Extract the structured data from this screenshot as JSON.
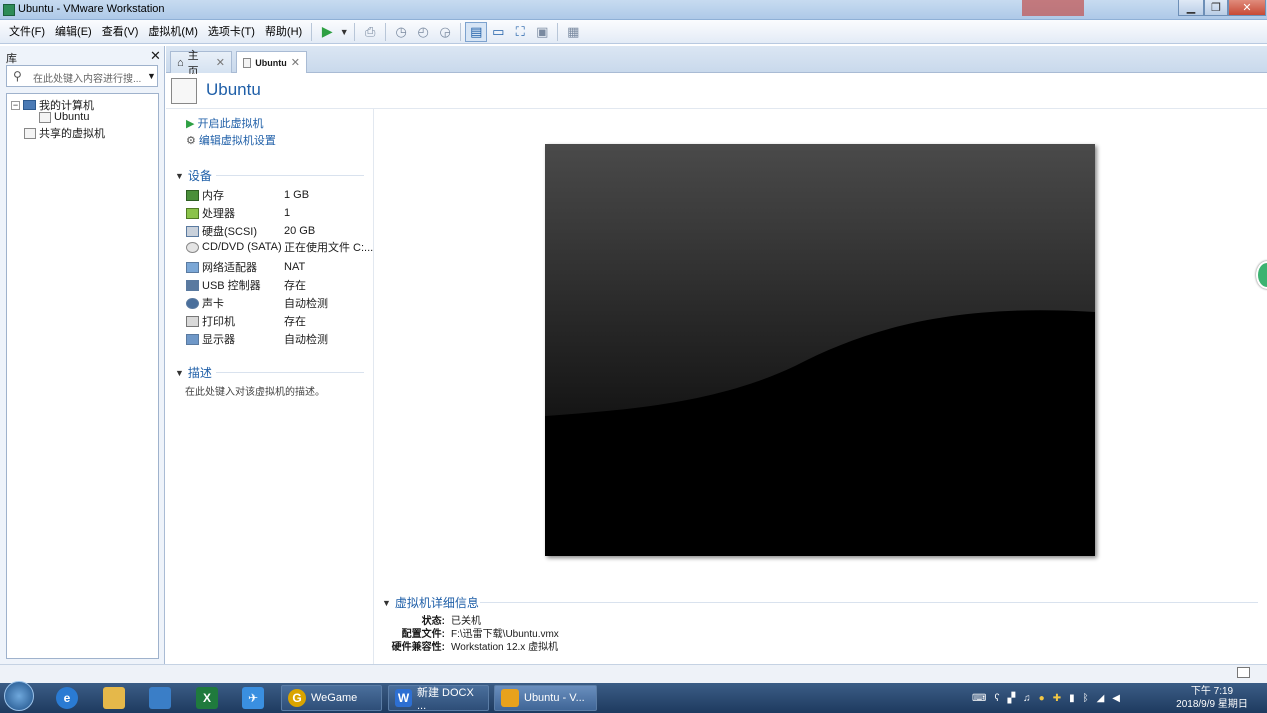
{
  "window": {
    "title": "Ubuntu - VMware Workstation"
  },
  "menu": [
    "文件(F)",
    "编辑(E)",
    "查看(V)",
    "虚拟机(M)",
    "选项卡(T)",
    "帮助(H)"
  ],
  "library": {
    "header": "库",
    "search_placeholder": "在此处键入内容进行搜...",
    "tree": {
      "my_computer": "我的计算机",
      "vm": "Ubuntu",
      "shared": "共享的虚拟机"
    }
  },
  "tabs": [
    {
      "label": "主页"
    },
    {
      "label": "Ubuntu"
    }
  ],
  "vm": {
    "name": "Ubuntu",
    "actions": {
      "power_on": "开启此虚拟机",
      "edit_settings": "编辑虚拟机设置"
    },
    "devices_header": "设备",
    "devices": [
      {
        "name": "内存",
        "value": "1 GB"
      },
      {
        "name": "处理器",
        "value": "1"
      },
      {
        "name": "硬盘(SCSI)",
        "value": "20 GB"
      },
      {
        "name": "CD/DVD (SATA)",
        "value": "正在使用文件 C:..."
      },
      {
        "name": "网络适配器",
        "value": "NAT"
      },
      {
        "name": "USB 控制器",
        "value": "存在"
      },
      {
        "name": "声卡",
        "value": "自动检测"
      },
      {
        "name": "打印机",
        "value": "存在"
      },
      {
        "name": "显示器",
        "value": "自动检测"
      }
    ],
    "description_header": "描述",
    "description_placeholder": "在此处键入对该虚拟机的描述。",
    "details": {
      "header": "虚拟机详细信息",
      "status_label": "状态:",
      "status_value": "已关机",
      "config_label": "配置文件:",
      "config_value": "F:\\迅雷下载\\Ubuntu.vmx",
      "compat_label": "硬件兼容性:",
      "compat_value": "Workstation 12.x 虚拟机"
    }
  },
  "taskbar": {
    "items": [
      "WeGame",
      "新建 DOCX ...",
      "Ubuntu - V..."
    ],
    "clock_time": "下午 7:19",
    "clock_date": "2018/9/9 星期日"
  },
  "colors": {
    "accent": "#1f5fa8",
    "play_green": "#2ea043"
  }
}
